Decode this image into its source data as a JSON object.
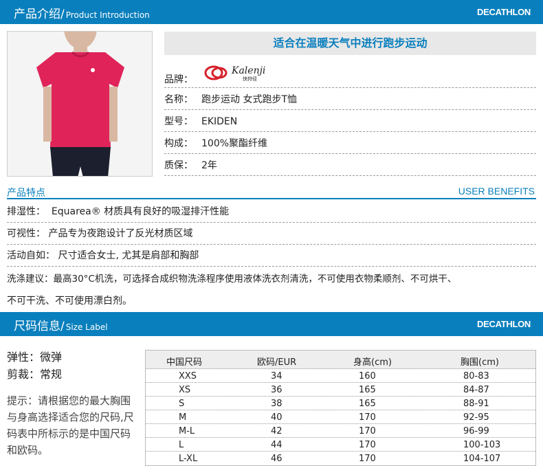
{
  "brand": "DECATHLON",
  "intro_header": {
    "title": "产品介绍/",
    "subtitle": "Product Introduction"
  },
  "slogan": "适合在温暖天气中进行跑步运动",
  "info": [
    {
      "label": "品牌：",
      "value": ""
    },
    {
      "label": "名称：",
      "value": "跑步运动 女式跑步T恤"
    },
    {
      "label": "型号：",
      "value": "EKIDEN"
    },
    {
      "label": "构成：",
      "value": "100%聚酯纤维"
    },
    {
      "label": "质保：",
      "value": "2年"
    }
  ],
  "kalenji_logo": {
    "name": "Kalenji",
    "cn": "快狩径"
  },
  "features_header": {
    "left": "产品特点",
    "right": "USER BENEFITS"
  },
  "features": [
    {
      "label": "排湿性：",
      "text": "Equarea® 材质具有良好的吸湿排汗性能"
    },
    {
      "label": "可视性：",
      "text": "产品专为夜跑设计了反光材质区域"
    },
    {
      "label": "活动自如：",
      "text": "尺寸适合女士, 尤其是肩部和胸部"
    },
    {
      "label": "洗涤建议：",
      "text": "最高30°C机洗，可选择合成织物洗涤程序使用液体洗衣剂清洗，不可使用衣物柔顺剂、不可烘干、"
    }
  ],
  "wash_cont": "不可干洗、不可使用漂白剂。",
  "size_header": {
    "title": "尺码信息/",
    "subtitle": "Size Label"
  },
  "elasticity": "弹性：微弹",
  "cut": "剪裁：常规",
  "tip": "提示：请根据您的最大胸围与身高选择适合您的尺码,尺码表中所标示的是中国尺码和欧码。",
  "size_table": {
    "headers": [
      "中国尺码",
      "欧码/EUR",
      "身高(cm)",
      "胸围(cm)"
    ],
    "rows": [
      [
        "XXS",
        "34",
        "160",
        "80-83"
      ],
      [
        "XS",
        "36",
        "165",
        "84-87"
      ],
      [
        "S",
        "38",
        "165",
        "88-91"
      ],
      [
        "M",
        "40",
        "170",
        "92-95"
      ],
      [
        "M-L",
        "42",
        "170",
        "96-99"
      ],
      [
        "L",
        "44",
        "170",
        "100-103"
      ],
      [
        "L-XL",
        "46",
        "170",
        "104-107"
      ]
    ]
  },
  "colors": {
    "accent": "#0a7fbd",
    "shirt": "#e0245a"
  }
}
